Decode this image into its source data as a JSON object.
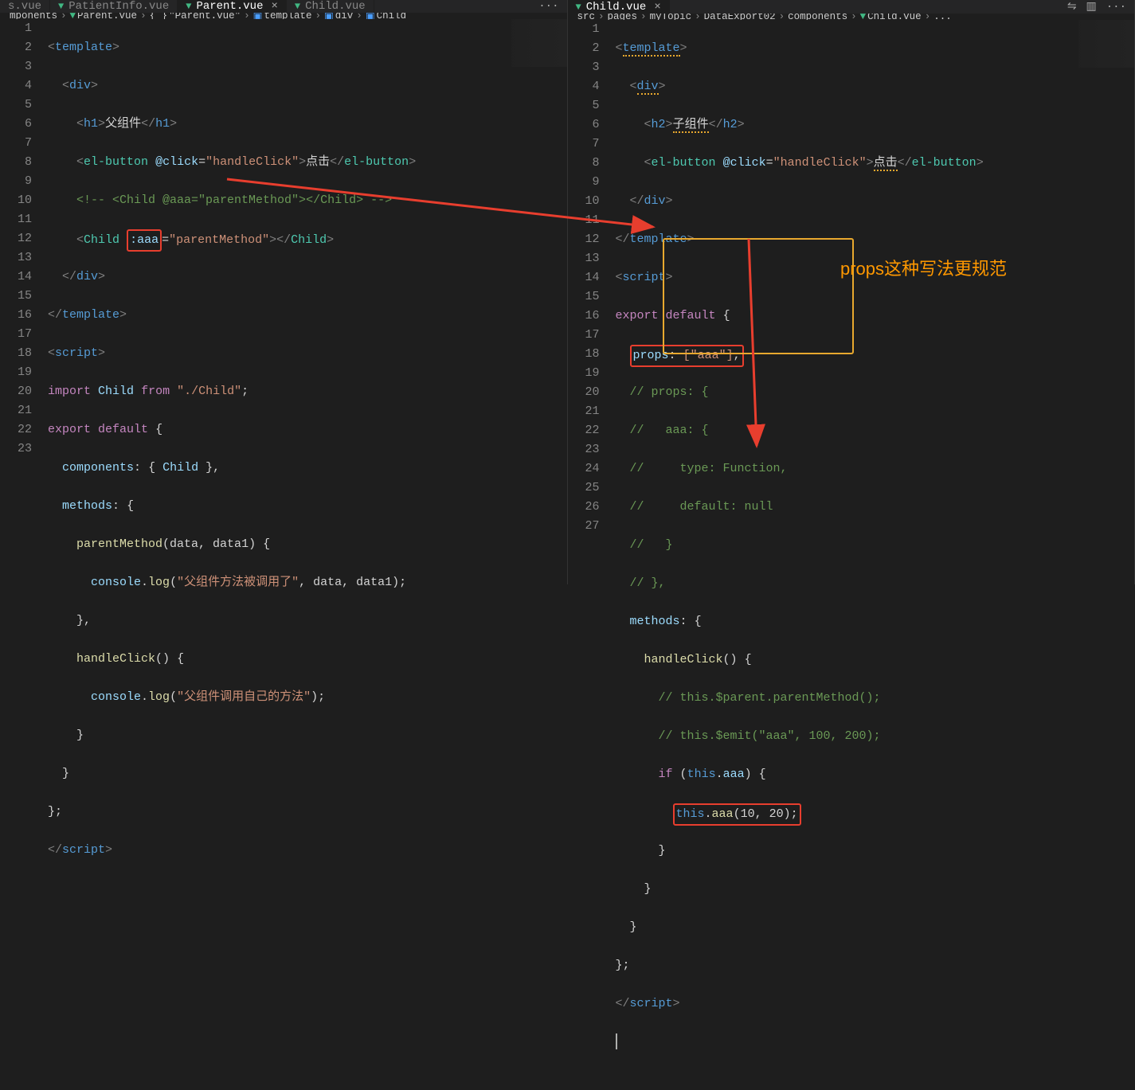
{
  "leftPane": {
    "tabs": [
      {
        "label": "s.vue",
        "active": false,
        "close": false
      },
      {
        "label": "PatientInfo.vue",
        "active": false,
        "close": false
      },
      {
        "label": "Parent.vue",
        "active": true,
        "close": true
      },
      {
        "label": "Child.vue",
        "active": false,
        "close": false
      }
    ],
    "overflow": "···",
    "breadcrumb": {
      "parts": [
        {
          "text": "mponents",
          "icon": ""
        },
        {
          "text": "Parent.vue",
          "icon": "vue"
        },
        {
          "text": "\"Parent.vue\"",
          "icon": "brace"
        },
        {
          "text": "template",
          "icon": "cube"
        },
        {
          "text": "div",
          "icon": "cube"
        },
        {
          "text": "Child",
          "icon": "cube"
        }
      ]
    },
    "code": {
      "line1": {
        "open": "<",
        "tag": "template",
        "close": ">"
      },
      "line2": {
        "open": "<",
        "tag": "div",
        "close": ">"
      },
      "line3": {
        "open": "<",
        "tag": "h1",
        "close": ">",
        "text": "父组件",
        "endopen": "</",
        "endclose": ">"
      },
      "line4": {
        "open": "<",
        "tag": "el-button",
        "attr": "@click",
        "eq": "=",
        "val": "\"handleClick\"",
        "close": ">",
        "text": "点击",
        "endopen": "</",
        "endclose": ">"
      },
      "line5": {
        "comment": "<!-- <Child @aaa=\"parentMethod\"></Child> -->"
      },
      "line6": {
        "open": "<",
        "tag": "Child",
        "attr": ":aaa",
        "eq": "=",
        "val": "\"parentMethod\"",
        "close": ">",
        "endopen": "</",
        "endtag": "Child",
        "endclose": ">"
      },
      "line7": {
        "open": "</",
        "tag": "div",
        "close": ">"
      },
      "line8": {
        "open": "</",
        "tag": "template",
        "close": ">"
      },
      "line9": {
        "open": "<",
        "tag": "script",
        "close": ">"
      },
      "line10": {
        "kw": "import",
        "name": "Child",
        "from": "from",
        "path": "\"./Child\"",
        "semi": ";"
      },
      "line11": {
        "kw1": "export",
        "kw2": "default",
        "brace": "{"
      },
      "line12": {
        "key": "components",
        "colon": ":",
        "brace1": "{",
        "val": "Child",
        "brace2": "}",
        "comma": ","
      },
      "line13": {
        "key": "methods",
        "colon": ":",
        "brace": "{"
      },
      "line14": {
        "fn": "parentMethod",
        "params": "(data, data1)",
        "brace": "{"
      },
      "line15": {
        "obj": "console",
        "dot": ".",
        "fn": "log",
        "paren1": "(",
        "str": "\"父组件方法被调用了\"",
        "rest": ", data, data1);"
      },
      "line16": {
        "close": "},"
      },
      "line17": {
        "fn": "handleClick",
        "params": "()",
        "brace": "{"
      },
      "line18": {
        "obj": "console",
        "dot": ".",
        "fn": "log",
        "paren1": "(",
        "str": "\"父组件调用自己的方法\"",
        "rest": ");"
      },
      "line19": {
        "close": "}"
      },
      "line20": {
        "close": "}"
      },
      "line21": {
        "close": "};"
      },
      "line22": {
        "open": "</",
        "tag": "script",
        "close": ">"
      }
    },
    "lineNumbers": [
      1,
      2,
      3,
      4,
      5,
      6,
      7,
      8,
      9,
      10,
      11,
      12,
      13,
      14,
      15,
      16,
      17,
      18,
      19,
      20,
      21,
      22,
      23
    ]
  },
  "rightPane": {
    "tabs": [
      {
        "label": "Child.vue",
        "active": true,
        "close": true
      }
    ],
    "breadcrumb": {
      "parts": [
        {
          "text": "src",
          "icon": ""
        },
        {
          "text": "pages",
          "icon": ""
        },
        {
          "text": "myTopic",
          "icon": ""
        },
        {
          "text": "DataExport02",
          "icon": ""
        },
        {
          "text": "components",
          "icon": ""
        },
        {
          "text": "Child.vue",
          "icon": "vue"
        },
        {
          "text": "...",
          "icon": ""
        }
      ]
    },
    "code": {
      "line1": {
        "open": "<",
        "tag": "template",
        "close": ">"
      },
      "line2": {
        "open": "<",
        "tag": "div",
        "close": ">"
      },
      "line3": {
        "open": "<",
        "tag": "h2",
        "close": ">",
        "text": "子组件",
        "endopen": "</",
        "endclose": ">"
      },
      "line4": {
        "open": "<",
        "tag": "el-button",
        "attr": "@click",
        "eq": "=",
        "val": "\"handleClick\"",
        "close": ">",
        "text": "点击",
        "endopen": "</",
        "endclose": ">"
      },
      "line5": {
        "open": "</",
        "tag": "div",
        "close": ">"
      },
      "line6": {
        "open": "</",
        "tag": "template",
        "close": ">"
      },
      "line7": {
        "open": "<",
        "tag": "script",
        "close": ">"
      },
      "line8": {
        "kw1": "export",
        "kw2": "default",
        "brace": "{"
      },
      "line9": {
        "key": "props",
        "colon": ":",
        "arr": "[\"aaa\"]",
        "comma": ","
      },
      "line10": {
        "comment": "// props: {"
      },
      "line11": {
        "comment": "//   aaa: {"
      },
      "line12": {
        "comment": "//     type: Function,"
      },
      "line13": {
        "comment": "//     default: null"
      },
      "line14": {
        "comment": "//   }"
      },
      "line15": {
        "comment": "// },"
      },
      "line16": {
        "key": "methods",
        "colon": ":",
        "brace": "{"
      },
      "line17": {
        "fn": "handleClick",
        "params": "()",
        "brace": "{"
      },
      "line18": {
        "comment": "// this.$parent.parentMethod();"
      },
      "line19": {
        "comment": "// this.$emit(\"aaa\", 100, 200);"
      },
      "line20": {
        "kw": "if",
        "paren1": "(",
        "thiskw": "this",
        "dot": ".",
        "prop": "aaa",
        "paren2": ")",
        "brace": "{"
      },
      "line21": {
        "thiskw": "this",
        "dot": ".",
        "fn": "aaa",
        "args": "(10, 20);"
      },
      "line22": {
        "close": "}"
      },
      "line23": {
        "close": "}"
      },
      "line24": {
        "close": "}"
      },
      "line25": {
        "close": "};"
      },
      "line26": {
        "open": "</",
        "tag": "script",
        "close": ">"
      },
      "line27": {
        "empty": ""
      }
    },
    "lineNumbers": [
      1,
      2,
      3,
      4,
      5,
      6,
      7,
      8,
      9,
      10,
      11,
      12,
      13,
      14,
      15,
      16,
      17,
      18,
      19,
      20,
      21,
      22,
      23,
      24,
      25,
      26,
      27
    ]
  },
  "annotation": "props这种写法更规范",
  "chart_data": null
}
